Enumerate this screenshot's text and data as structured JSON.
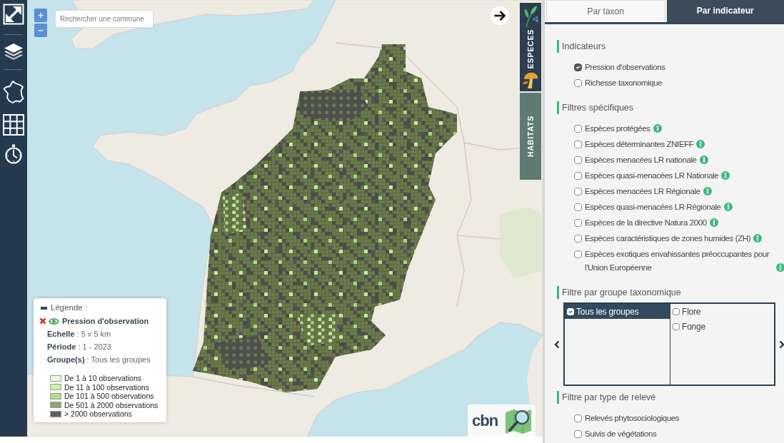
{
  "map": {
    "zoom_buttons": [
      "+",
      "−"
    ],
    "search": {
      "placeholder": "Rechercher une commune"
    },
    "side_tabs": [
      {
        "label": "ESPECES",
        "selected": true
      },
      {
        "label": "HABITATS",
        "selected": false
      }
    ],
    "legend": {
      "title": "Légende :",
      "layer": {
        "name": "Pression d'observation",
        "visible": true
      },
      "details": [
        "**Echelle** : 5 x 5 km",
        "**Période** : 1 - 2023",
        "**Groupe(s)** : Tous les groupes"
      ],
      "classes": [
        {
          "label": "De 1 à 10 observations",
          "color": "#eaf8dc"
        },
        {
          "label": "De 11 à 100 observations",
          "color": "#c9f2a9"
        },
        {
          "label": "De 101 à 500 observations",
          "color": "#a9e08a"
        },
        {
          "label": "De 501 à 2000 observations",
          "color": "#86a86a"
        },
        {
          "label": "> 2000 observations",
          "color": "#5f5f5f"
        }
      ]
    },
    "logo": {
      "text": "cbn"
    }
  },
  "panel": {
    "tabs": [
      {
        "label": "Par taxon",
        "selected": false
      },
      {
        "label": "Par indicateur",
        "selected": true
      }
    ],
    "sections": [
      {
        "title": "Indicateurs",
        "kind": "checklist",
        "items": [
          {
            "label": "Pression d'observations",
            "checked": true,
            "info": false
          },
          {
            "label": "Richesse taxonomique",
            "checked": false,
            "info": false
          }
        ]
      },
      {
        "title": "Filtres spécifiques",
        "kind": "checklist",
        "items": [
          {
            "label": "Espèces protégées",
            "checked": false,
            "info": true
          },
          {
            "label": "Espèces déterminantes ZNIEFF",
            "checked": false,
            "info": true
          },
          {
            "label": "Espèces menacées LR nationale",
            "checked": false,
            "info": true
          },
          {
            "label": "Espèces quasi-menacées LR Nationale",
            "checked": false,
            "info": true
          },
          {
            "label": "Espèces menacées LR Régionale",
            "checked": false,
            "info": true
          },
          {
            "label": "Espèces quasi-menacées LR Régionale",
            "checked": false,
            "info": true
          },
          {
            "label": "Espèces de la directive Natura 2000",
            "checked": false,
            "info": true
          },
          {
            "label": "Espèces caractéristiques de zones humides (ZH)",
            "checked": false,
            "info": true
          },
          {
            "label": "Espèces exotiques envahissantes préoccupantes pour l'Union Européenne",
            "checked": false,
            "info": true
          }
        ]
      },
      {
        "title": "Filtre par groupe taxonomique",
        "kind": "groups",
        "columns": [
          [
            {
              "label": "Tous les groupes",
              "checked": true
            }
          ],
          [
            {
              "label": "Flore",
              "checked": false
            },
            {
              "label": "Fonge",
              "checked": false
            }
          ]
        ]
      },
      {
        "title": "Filtre par type de relevé",
        "kind": "checklist",
        "items": [
          {
            "label": "Relevés phytosociologiques",
            "checked": false,
            "info": false
          },
          {
            "label": "Suivis de végétations",
            "checked": false,
            "info": false
          }
        ]
      }
    ]
  }
}
